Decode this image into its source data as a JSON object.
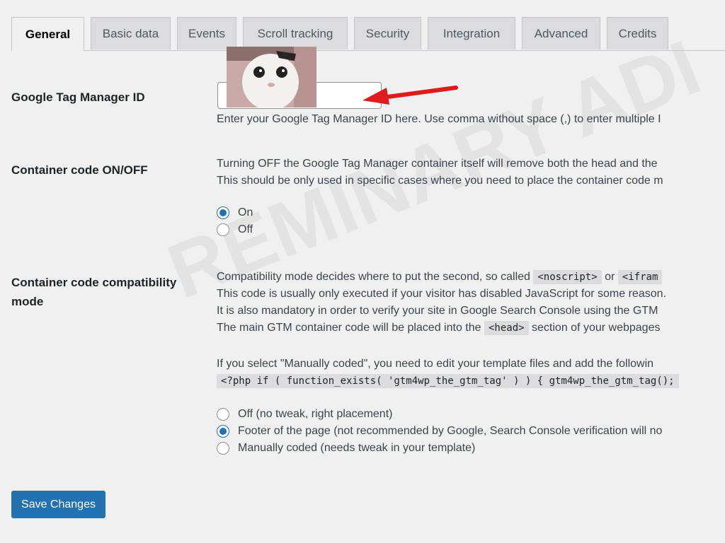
{
  "tabs": [
    {
      "label": "General",
      "active": true
    },
    {
      "label": "Basic data",
      "active": false
    },
    {
      "label": "Events",
      "active": false
    },
    {
      "label": "Scroll tracking",
      "active": false
    },
    {
      "label": "Security",
      "active": false
    },
    {
      "label": "Integration",
      "active": false
    },
    {
      "label": "Advanced",
      "active": false
    },
    {
      "label": "Credits",
      "active": false
    }
  ],
  "gtm_id": {
    "label": "Google Tag Manager ID",
    "value": "",
    "help": "Enter your Google Tag Manager ID here. Use comma without space (,) to enter multiple I"
  },
  "container_onoff": {
    "label": "Container code ON/OFF",
    "desc_line1": "Turning OFF the Google Tag Manager container itself will remove both the head and the",
    "desc_line2": "This should be only used in specific cases where you need to place the container code m",
    "options": [
      {
        "label": "On",
        "checked": true
      },
      {
        "label": "Off",
        "checked": false
      }
    ]
  },
  "compat_mode": {
    "label": "Container code compatibility mode",
    "line1_pre": "Compatibility mode decides where to put the second, so called",
    "code_noscript": "<noscript>",
    "line1_mid": "or",
    "code_iframe": "<ifram",
    "line2": "This code is usually only executed if your visitor has disabled JavaScript for some reason.",
    "line3": "It is also mandatory in order to verify your site in Google Search Console using the GTM",
    "line4_pre": "The main GTM container code will be placed into the",
    "code_head": "<head>",
    "line4_post": "section of your webpages",
    "line5": "If you select \"Manually coded\", you need to edit your template files and add the followin",
    "code_php": "<?php if ( function_exists( 'gtm4wp_the_gtm_tag' ) ) { gtm4wp_the_gtm_tag();",
    "options": [
      {
        "label": "Off (no tweak, right placement)",
        "checked": false
      },
      {
        "label": "Footer of the page (not recommended by Google, Search Console verification will no",
        "checked": true
      },
      {
        "label": "Manually coded (needs tweak in your template)",
        "checked": false
      }
    ]
  },
  "save_label": "Save Changes",
  "watermark": "REMINARY ADI",
  "colors": {
    "accent": "#2271b1",
    "arrow": "#e01b1b",
    "background": "#f0f0f1"
  }
}
